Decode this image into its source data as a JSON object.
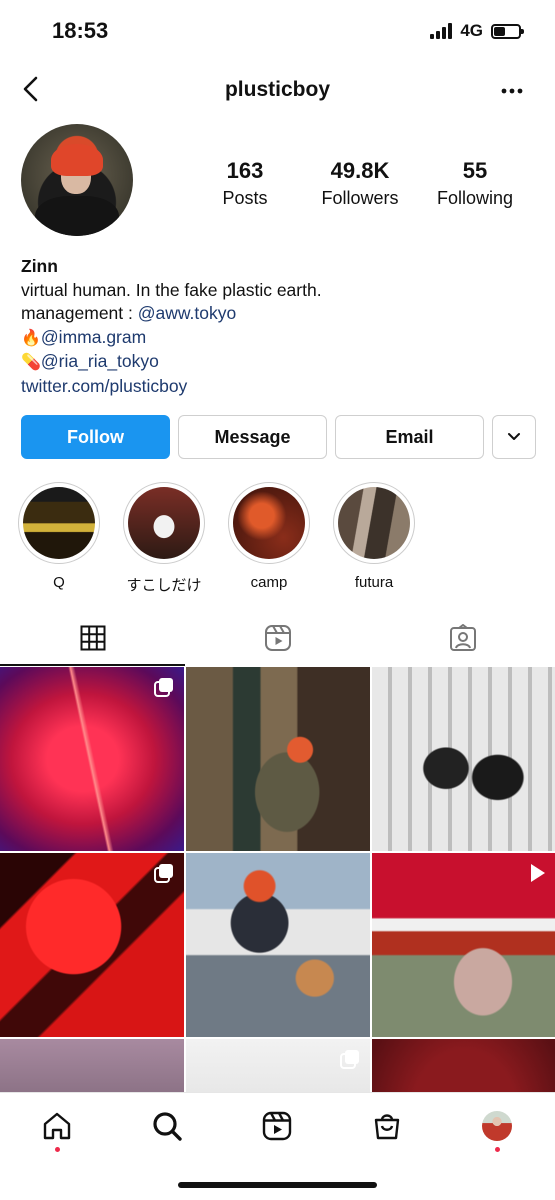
{
  "status_bar": {
    "time": "18:53",
    "network": "4G"
  },
  "header": {
    "username": "plusticboy"
  },
  "profile": {
    "stats": [
      {
        "value": "163",
        "label": "Posts"
      },
      {
        "value": "49.8K",
        "label": "Followers"
      },
      {
        "value": "55",
        "label": "Following"
      }
    ]
  },
  "bio": {
    "name": "Zinn",
    "line1": "virtual human. In the fake plastic earth.",
    "line2_prefix": "management : ",
    "line2_link": "@aww.tokyo",
    "line3_emoji": "🔥",
    "line3_link": "@imma.gram",
    "line4_emoji": "💊",
    "line4_link": "@ria_ria_tokyo",
    "website": "twitter.com/plusticboy"
  },
  "actions": {
    "follow": "Follow",
    "message": "Message",
    "email": "Email"
  },
  "highlights": [
    {
      "label": "Q"
    },
    {
      "label": "すこしだけ"
    },
    {
      "label": "camp"
    },
    {
      "label": "futura"
    }
  ],
  "tabs": [
    {
      "icon": "grid-icon",
      "active": true
    },
    {
      "icon": "reels-icon",
      "active": false
    },
    {
      "icon": "tagged-icon",
      "active": false
    }
  ],
  "posts": [
    {
      "type": "multi"
    },
    {
      "type": "single"
    },
    {
      "type": "single"
    },
    {
      "type": "multi"
    },
    {
      "type": "single"
    },
    {
      "type": "reel"
    },
    {
      "type": "single"
    },
    {
      "type": "multi"
    },
    {
      "type": "single"
    }
  ],
  "bottom_nav": [
    "home-icon",
    "search-icon",
    "reels-icon",
    "shop-icon",
    "profile-avatar"
  ],
  "colors": {
    "accent": "#1a95f0",
    "link": "#1e3a6e",
    "notification": "#ee2a4b"
  }
}
